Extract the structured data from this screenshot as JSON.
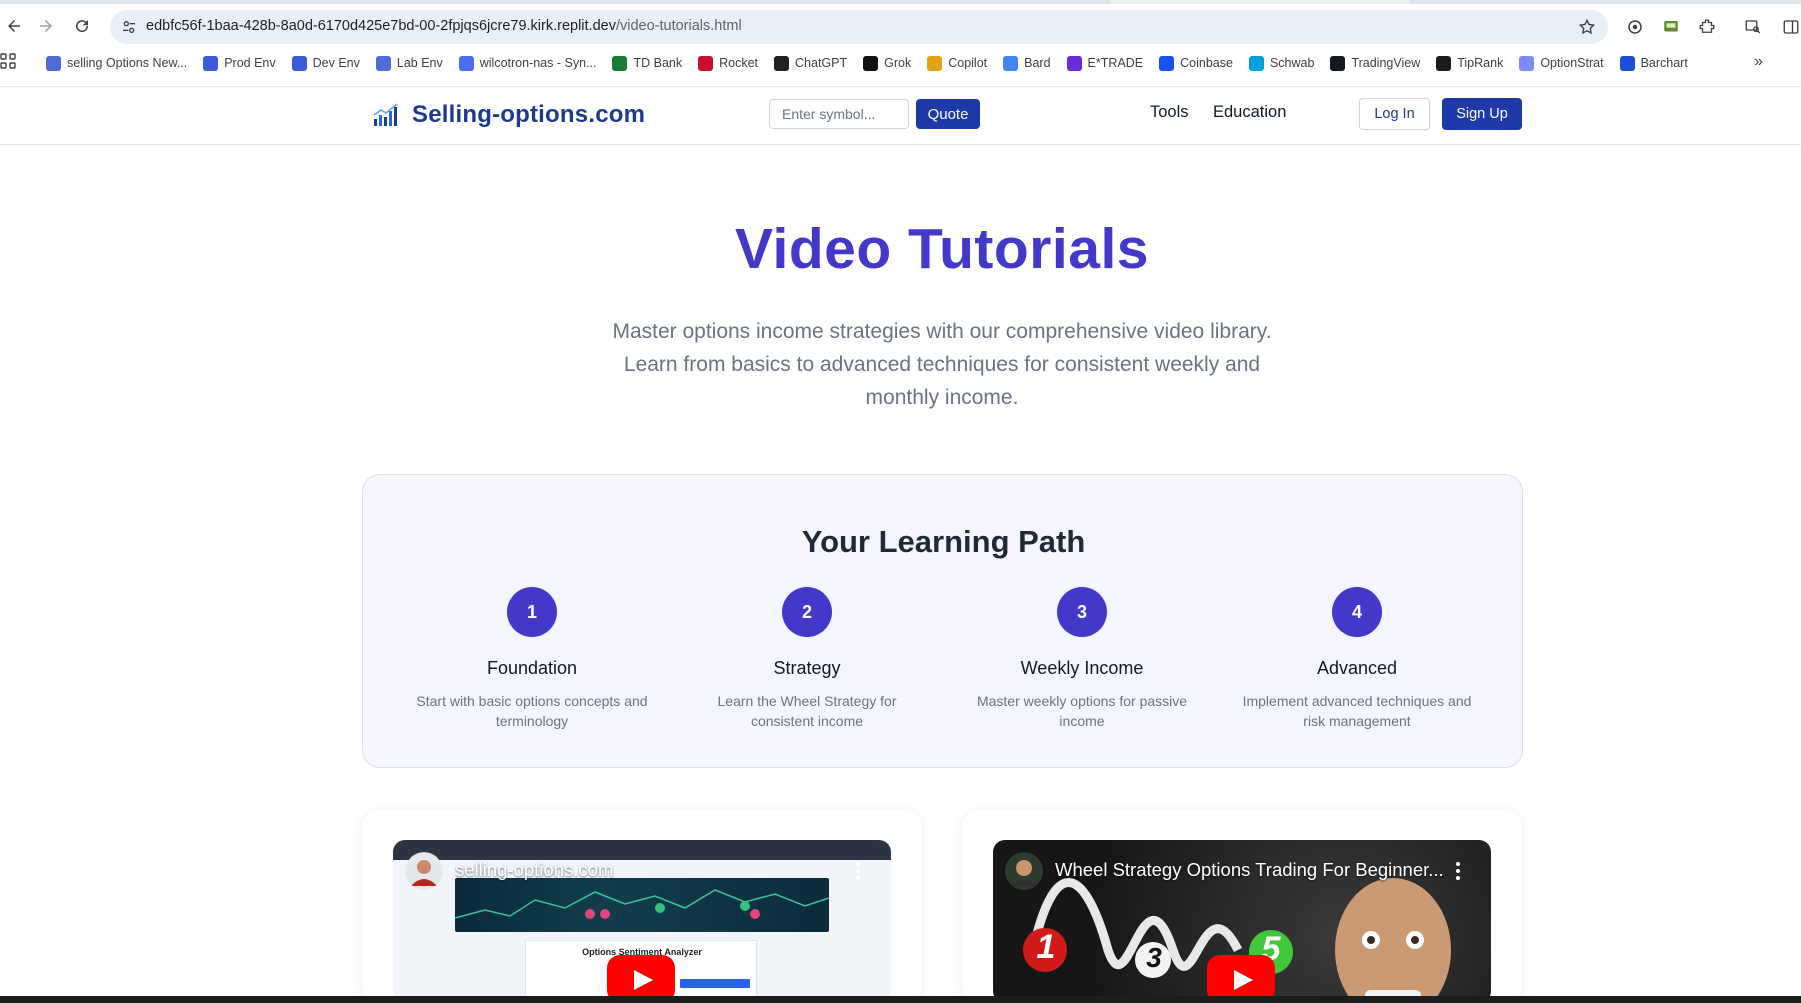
{
  "browser": {
    "url_host": "edbfc56f-1baa-428b-8a0d-6170d425e7bd-00-2fpjqs6jcre79.kirk.replit.dev",
    "url_path": "/video-tutorials.html",
    "bookmarks": [
      {
        "label": "selling Options New...",
        "icon": "chart-icon",
        "color": "#4f6bd8"
      },
      {
        "label": "Prod Env",
        "icon": "so-icon",
        "color": "#3b5bdb"
      },
      {
        "label": "Dev Env",
        "icon": "so-icon",
        "color": "#3b5bdb"
      },
      {
        "label": "Lab Env",
        "icon": "chart-icon",
        "color": "#4f6bd8"
      },
      {
        "label": "wilcotron-nas - Syn...",
        "icon": "dsm-icon",
        "color": "#4a6cf7"
      },
      {
        "label": "TD Bank",
        "icon": "td-icon",
        "color": "#1a7d32"
      },
      {
        "label": "Rocket",
        "icon": "rocket-icon",
        "color": "#c8102e"
      },
      {
        "label": "ChatGPT",
        "icon": "openai-icon",
        "color": "#202123"
      },
      {
        "label": "Grok",
        "icon": "grok-icon",
        "color": "#111111"
      },
      {
        "label": "Copilot",
        "icon": "copilot-icon",
        "color": "#e3a21a"
      },
      {
        "label": "Bard",
        "icon": "sparkle-icon",
        "color": "#4285f4"
      },
      {
        "label": "E*TRADE",
        "icon": "etrade-icon",
        "color": "#6b2bd8"
      },
      {
        "label": "Coinbase",
        "icon": "coinbase-icon",
        "color": "#1652f0"
      },
      {
        "label": "Schwab",
        "icon": "schwab-icon",
        "color": "#00a0df"
      },
      {
        "label": "TradingView",
        "icon": "tradingview-icon",
        "color": "#131722"
      },
      {
        "label": "TipRank",
        "icon": "tipranks-icon",
        "color": "#1b1b1b"
      },
      {
        "label": "OptionStrat",
        "icon": "optionstrat-icon",
        "color": "#7c8cf8"
      },
      {
        "label": "Barchart",
        "icon": "barchart-icon",
        "color": "#1d4ed8"
      }
    ]
  },
  "header": {
    "brand": "Selling-options.com",
    "symbol_placeholder": "Enter symbol...",
    "quote_label": "Quote",
    "nav": [
      "Tools",
      "Education"
    ],
    "login_label": "Log In",
    "signup_label": "Sign Up"
  },
  "hero": {
    "title": "Video Tutorials",
    "subtitle": "Master options income strategies with our comprehensive video library. Learn from basics to advanced techniques for consistent weekly and monthly income."
  },
  "learning_path": {
    "title": "Your Learning Path",
    "steps": [
      {
        "num": "1",
        "label": "Foundation",
        "desc": "Start with basic options concepts and terminology"
      },
      {
        "num": "2",
        "label": "Strategy",
        "desc": "Learn the Wheel Strategy for consistent income"
      },
      {
        "num": "3",
        "label": "Weekly Income",
        "desc": "Master weekly options for passive income"
      },
      {
        "num": "4",
        "label": "Advanced",
        "desc": "Implement advanced techniques and risk management"
      }
    ]
  },
  "videos": [
    {
      "title": "selling-options.com",
      "inner_heading": "Options Sentiment Analyzer"
    },
    {
      "title": "Wheel Strategy Options Trading For Beginner...",
      "numbers": [
        "1",
        "3",
        "5"
      ]
    }
  ],
  "colors": {
    "brand_indigo": "#4338ca",
    "brand_navy": "#1e3aa8",
    "youtube_red": "#ff0000"
  }
}
